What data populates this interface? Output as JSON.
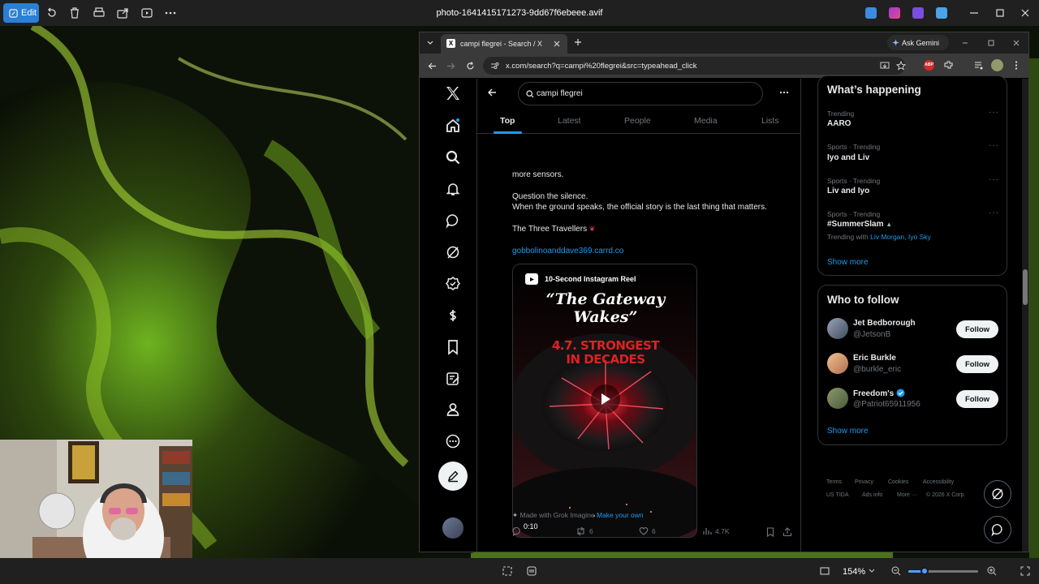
{
  "photos_app": {
    "edit_label": "Edit",
    "file_title": "photo-1641415171273-9dd67f6ebeee.avif",
    "zoom_level": "154%"
  },
  "browser": {
    "tab_title": "campi flegrei - Search / X",
    "ask_gemini": "Ask Gemini",
    "url": "x.com/search?q=campi%20flegrei&src=typeahead_click"
  },
  "x": {
    "search_query": "campi flegrei",
    "tabs": [
      "Top",
      "Latest",
      "People",
      "Media",
      "Lists"
    ],
    "post": {
      "line1": "more sensors.",
      "line2": "Question the silence.",
      "line3": "When the ground speaks, the official story is the last thing that matters.",
      "signature": "The Three Travellers",
      "link": "gobbolinoanddave369.carrd.co",
      "video": {
        "label": "10-Second Instagram Reel",
        "title": "“The Gateway Wakes”",
        "headline_1": "4.7. STRONGEST",
        "headline_2": "IN DECADES",
        "duration": "0:10"
      },
      "grok_made": "Made with Grok Imagine",
      "grok_cta": "Make your own",
      "retweets": "6",
      "likes": "6",
      "views": "4.7K"
    },
    "whats_happening": {
      "title": "What’s happening",
      "trends": [
        {
          "meta": "Trending",
          "name": "AARO"
        },
        {
          "meta": "Sports · Trending",
          "name": "Iyo and Liv"
        },
        {
          "meta": "Sports · Trending",
          "name": "Liv and Iyo"
        },
        {
          "meta": "Sports · Trending",
          "name": "#SummerSlam",
          "with_prefix": "Trending with",
          "with_links": "Liv Morgan, Iyo Sky"
        }
      ],
      "show_more": "Show more"
    },
    "who_to_follow": {
      "title": "Who to follow",
      "users": [
        {
          "name": "Jet Bedborough",
          "handle": "@JetsonB",
          "button": "Follow"
        },
        {
          "name": "Eric Burkle",
          "handle": "@burkle_eric",
          "button": "Follow"
        },
        {
          "name": "Freedom's",
          "handle": "@Patriot65911956",
          "button": "Follow"
        }
      ],
      "show_more": "Show more"
    },
    "footer": {
      "terms": "Terms",
      "privacy": "Privacy",
      "cookies": "Cookies",
      "accessibility": "Accessibility",
      "us_tida": "US TIDA",
      "ads_info": "Ads info",
      "more": "More ···",
      "copyright": "© 2026 X Corp."
    }
  }
}
